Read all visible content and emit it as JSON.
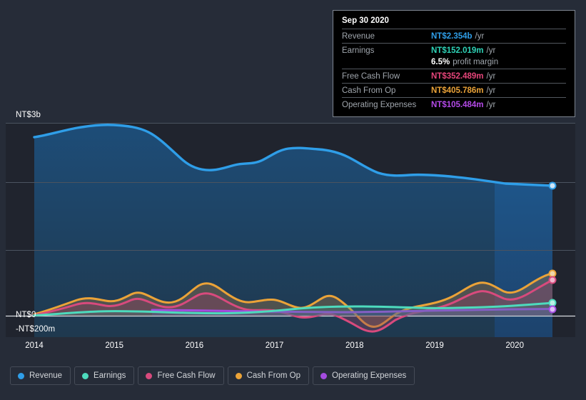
{
  "background_color": "#262c38",
  "axis": {
    "y_top_label": "NT$3b",
    "y_zero_label": "NT$0",
    "y_bottom_label": "-NT$200m",
    "x_ticks": [
      "2014",
      "2015",
      "2016",
      "2017",
      "2018",
      "2019",
      "2020"
    ]
  },
  "tooltip": {
    "date": "Sep 30 2020",
    "rows": [
      {
        "key": "Revenue",
        "value": "NT$2.354b",
        "unit": "/yr",
        "color": "#2f9ee8"
      },
      {
        "key": "Earnings",
        "value": "NT$152.019m",
        "unit": "/yr",
        "color": "#2ed3b7"
      },
      {
        "key": "",
        "value": "6.5%",
        "unit": "",
        "sub": "profit margin",
        "color": "#ffffff"
      },
      {
        "key": "Free Cash Flow",
        "value": "NT$352.489m",
        "unit": "/yr",
        "color": "#e6457a"
      },
      {
        "key": "Cash From Op",
        "value": "NT$405.786m",
        "unit": "/yr",
        "color": "#eba338"
      },
      {
        "key": "Operating Expenses",
        "value": "NT$105.484m",
        "unit": "/yr",
        "color": "#b44ae8"
      }
    ]
  },
  "legend": [
    {
      "label": "Revenue",
      "color": "#2f9ee8"
    },
    {
      "label": "Earnings",
      "color": "#4ddbbd"
    },
    {
      "label": "Free Cash Flow",
      "color": "#d84a7d"
    },
    {
      "label": "Cash From Op",
      "color": "#eba338"
    },
    {
      "label": "Operating Expenses",
      "color": "#a44ce0"
    }
  ],
  "chart_data": {
    "type": "area",
    "title": "",
    "xlabel": "",
    "ylabel": "",
    "currency": "NT$",
    "period": "/yr",
    "ylim": [
      -200000000,
      3000000000
    ],
    "y_gridlines": [
      3000000000,
      2000000000,
      1000000000,
      0,
      -200000000
    ],
    "x": [
      "2014",
      "2015",
      "2016",
      "2017",
      "2018",
      "2019",
      "2020",
      "Sep 30 2020"
    ],
    "grid": true,
    "legend_position": "bottom",
    "highlight_band": {
      "from": "2020-01",
      "to": "2020-09",
      "note": "latest period shading"
    },
    "series": [
      {
        "name": "Revenue",
        "color": "#2f9ee8",
        "filled": true,
        "latest_value": "NT$2.354b",
        "points": [
          {
            "x": 2014.0,
            "y": 2.98
          },
          {
            "x": 2014.35,
            "y": 3.05
          },
          {
            "x": 2014.7,
            "y": 3.15
          },
          {
            "x": 2015.0,
            "y": 3.22
          },
          {
            "x": 2015.25,
            "y": 3.22
          },
          {
            "x": 2015.6,
            "y": 3.12
          },
          {
            "x": 2016.0,
            "y": 2.78
          },
          {
            "x": 2016.3,
            "y": 2.58
          },
          {
            "x": 2016.6,
            "y": 2.56
          },
          {
            "x": 2017.0,
            "y": 2.62
          },
          {
            "x": 2017.25,
            "y": 2.8
          },
          {
            "x": 2017.6,
            "y": 2.78
          },
          {
            "x": 2018.0,
            "y": 2.86
          },
          {
            "x": 2018.3,
            "y": 2.96
          },
          {
            "x": 2018.6,
            "y": 2.95
          },
          {
            "x": 2019.0,
            "y": 2.88
          },
          {
            "x": 2019.4,
            "y": 2.62
          },
          {
            "x": 2019.8,
            "y": 2.46
          },
          {
            "x": 2020.0,
            "y": 2.45
          },
          {
            "x": 2020.4,
            "y": 2.44
          },
          {
            "x": 2020.75,
            "y": 2.354
          }
        ]
      },
      {
        "name": "Earnings",
        "color": "#4ddbbd",
        "filled": true,
        "latest_value": "NT$152.019m",
        "points": [
          {
            "x": 2014.0,
            "y": 0.005
          },
          {
            "x": 2015.0,
            "y": 0.055
          },
          {
            "x": 2016.0,
            "y": 0.062
          },
          {
            "x": 2017.0,
            "y": 0.045
          },
          {
            "x": 2017.6,
            "y": 0.052
          },
          {
            "x": 2018.0,
            "y": 0.085
          },
          {
            "x": 2018.6,
            "y": 0.115
          },
          {
            "x": 2019.0,
            "y": 0.12
          },
          {
            "x": 2019.6,
            "y": 0.11
          },
          {
            "x": 2020.0,
            "y": 0.105
          },
          {
            "x": 2020.4,
            "y": 0.125
          },
          {
            "x": 2020.75,
            "y": 0.152
          }
        ]
      },
      {
        "name": "Free Cash Flow",
        "color": "#d84a7d",
        "filled": true,
        "latest_value": "NT$352.489m",
        "points": [
          {
            "x": 2014.0,
            "y": 0.01
          },
          {
            "x": 2014.6,
            "y": 0.06
          },
          {
            "x": 2015.0,
            "y": 0.12
          },
          {
            "x": 2015.4,
            "y": 0.09
          },
          {
            "x": 2015.8,
            "y": 0.19
          },
          {
            "x": 2016.0,
            "y": 0.17
          },
          {
            "x": 2016.4,
            "y": 0.07
          },
          {
            "x": 2016.8,
            "y": 0.16
          },
          {
            "x": 2017.0,
            "y": 0.2
          },
          {
            "x": 2017.4,
            "y": 0.12
          },
          {
            "x": 2017.8,
            "y": 0.02
          },
          {
            "x": 2018.2,
            "y": -0.02
          },
          {
            "x": 2018.6,
            "y": -0.05
          },
          {
            "x": 2019.0,
            "y": -0.18
          },
          {
            "x": 2019.25,
            "y": -0.08
          },
          {
            "x": 2019.6,
            "y": 0.03
          },
          {
            "x": 2020.0,
            "y": 0.06
          },
          {
            "x": 2020.35,
            "y": 0.26
          },
          {
            "x": 2020.55,
            "y": 0.2
          },
          {
            "x": 2020.75,
            "y": 0.352
          }
        ]
      },
      {
        "name": "Cash From Op",
        "color": "#eba338",
        "filled": true,
        "latest_value": "NT$405.786m",
        "points": [
          {
            "x": 2014.0,
            "y": 0.02
          },
          {
            "x": 2014.6,
            "y": 0.1
          },
          {
            "x": 2015.0,
            "y": 0.15
          },
          {
            "x": 2015.4,
            "y": 0.12
          },
          {
            "x": 2015.8,
            "y": 0.22
          },
          {
            "x": 2016.0,
            "y": 0.2
          },
          {
            "x": 2016.4,
            "y": 0.1
          },
          {
            "x": 2016.8,
            "y": 0.22
          },
          {
            "x": 2017.0,
            "y": 0.27
          },
          {
            "x": 2017.4,
            "y": 0.17
          },
          {
            "x": 2017.8,
            "y": 0.09
          },
          {
            "x": 2018.2,
            "y": 0.1
          },
          {
            "x": 2018.4,
            "y": 0.18
          },
          {
            "x": 2018.8,
            "y": 0.08
          },
          {
            "x": 2019.0,
            "y": -0.14
          },
          {
            "x": 2019.25,
            "y": -0.05
          },
          {
            "x": 2019.6,
            "y": 0.05
          },
          {
            "x": 2020.0,
            "y": 0.09
          },
          {
            "x": 2020.35,
            "y": 0.3
          },
          {
            "x": 2020.55,
            "y": 0.24
          },
          {
            "x": 2020.75,
            "y": 0.406
          }
        ]
      },
      {
        "name": "Operating Expenses",
        "color": "#a44ce0",
        "filled": true,
        "latest_value": "NT$105.484m",
        "points": [
          {
            "x": 2015.78,
            "y": 0.085
          },
          {
            "x": 2016.4,
            "y": 0.082
          },
          {
            "x": 2017.0,
            "y": 0.08
          },
          {
            "x": 2017.6,
            "y": 0.076
          },
          {
            "x": 2018.0,
            "y": 0.075
          },
          {
            "x": 2018.6,
            "y": 0.08
          },
          {
            "x": 2019.0,
            "y": 0.09
          },
          {
            "x": 2019.6,
            "y": 0.095
          },
          {
            "x": 2020.0,
            "y": 0.098
          },
          {
            "x": 2020.4,
            "y": 0.102
          },
          {
            "x": 2020.75,
            "y": 0.105
          }
        ]
      }
    ]
  }
}
